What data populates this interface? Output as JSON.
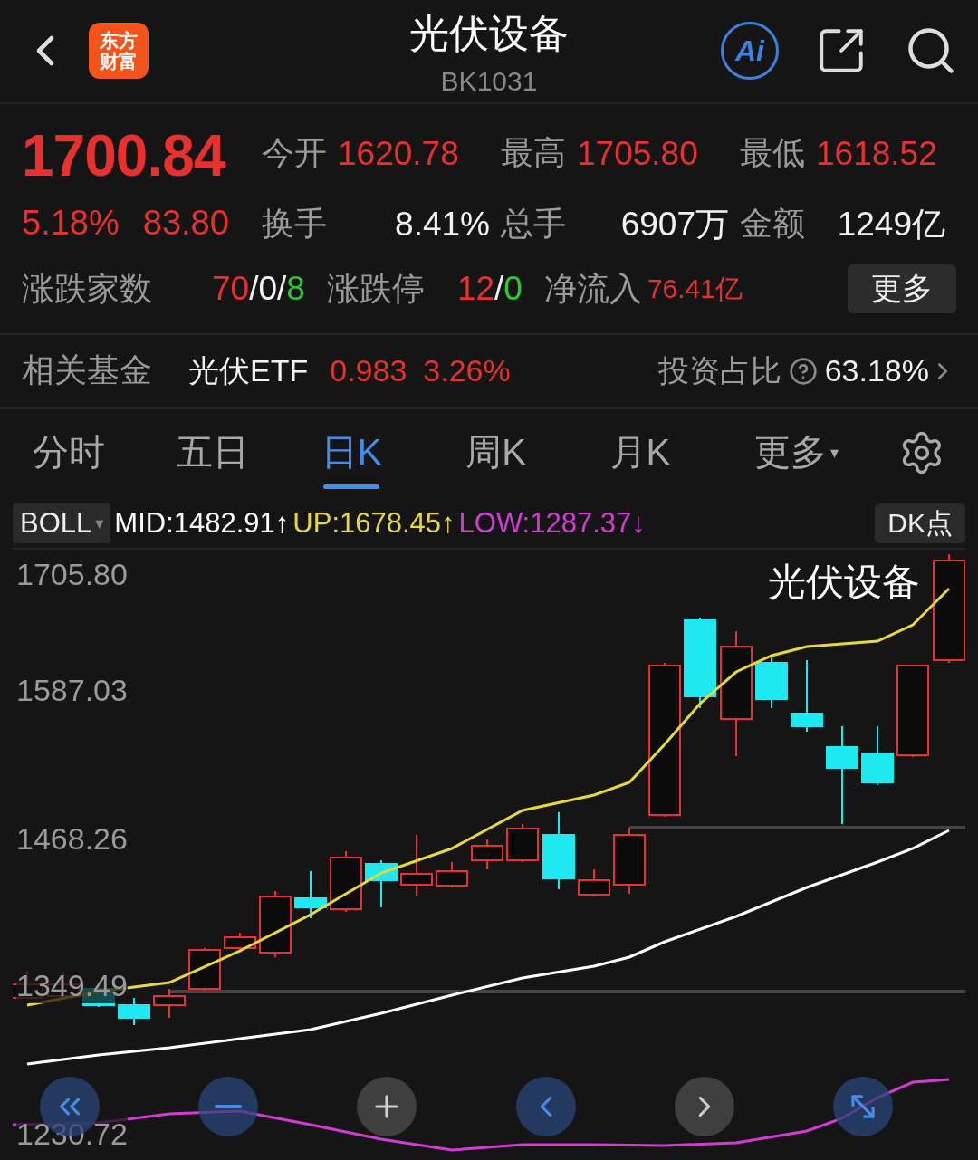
{
  "header": {
    "logo": [
      "东方",
      "财富"
    ],
    "title": "光伏设备",
    "code": "BK1031",
    "ai_label": "Ai"
  },
  "quote": {
    "price": "1700.84",
    "change_pct": "5.18%",
    "change": "83.80",
    "color": "#e8302f"
  },
  "stats": [
    {
      "label": "今开",
      "value": "1620.78",
      "color": "#e8302f"
    },
    {
      "label": "最高",
      "value": "1705.80",
      "color": "#e8302f"
    },
    {
      "label": "最低",
      "value": "1618.52",
      "color": "#e8302f"
    },
    {
      "label": "换手",
      "value": "8.41%",
      "color": "#f2f2f2"
    },
    {
      "label": "总手",
      "value": "6907万",
      "color": "#f2f2f2"
    },
    {
      "label": "金额",
      "value": "1249亿",
      "color": "#f2f2f2"
    }
  ],
  "breadth": {
    "label": "涨跌家数",
    "parts": [
      {
        "text": "70",
        "color": "#e8302f"
      },
      {
        "text": "/",
        "color": "#f2f2f2"
      },
      {
        "text": "0",
        "color": "#f2f2f2"
      },
      {
        "text": "/",
        "color": "#f2f2f2"
      },
      {
        "text": "8",
        "color": "#2fc43a"
      }
    ]
  },
  "limits": {
    "label": "涨跌停",
    "parts": [
      {
        "text": "12",
        "color": "#e8302f"
      },
      {
        "text": "/",
        "color": "#f2f2f2"
      },
      {
        "text": "0",
        "color": "#2fc43a"
      }
    ]
  },
  "inflow": {
    "label": "净流入",
    "value": "76.41亿"
  },
  "more_button": "更多",
  "fund": {
    "label": "相关基金",
    "name": "光伏ETF",
    "price": "0.983",
    "change": "3.26%",
    "ratio_label": "投资占比",
    "ratio": "63.18%"
  },
  "tabs": [
    {
      "label": "分时",
      "selected": false
    },
    {
      "label": "五日",
      "selected": false
    },
    {
      "label": "日K",
      "selected": true
    },
    {
      "label": "周K",
      "selected": false
    },
    {
      "label": "月K",
      "selected": false
    },
    {
      "label": "更多",
      "selected": false,
      "caret": "▾"
    }
  ],
  "indicator": {
    "name": "BOLL",
    "caret": "▾",
    "values": [
      {
        "text": "MID:1482.91",
        "arrow": "↑",
        "color": "#ffffff"
      },
      {
        "text": "UP:1678.45",
        "arrow": "↑",
        "color": "#e8d840"
      },
      {
        "text": "LOW:1287.37",
        "arrow": "↓",
        "color": "#d43ad4"
      }
    ],
    "dk_button": "DK点"
  },
  "chart": {
    "title": "光伏设备",
    "y_labels": [
      "1705.80",
      "1587.03",
      "1468.26",
      "1349.49",
      "1230.72"
    ]
  },
  "controls": [
    {
      "active": true
    },
    {
      "active": true
    },
    {
      "active": false
    },
    {
      "active": true
    },
    {
      "active": false
    },
    {
      "active": true
    }
  ]
}
